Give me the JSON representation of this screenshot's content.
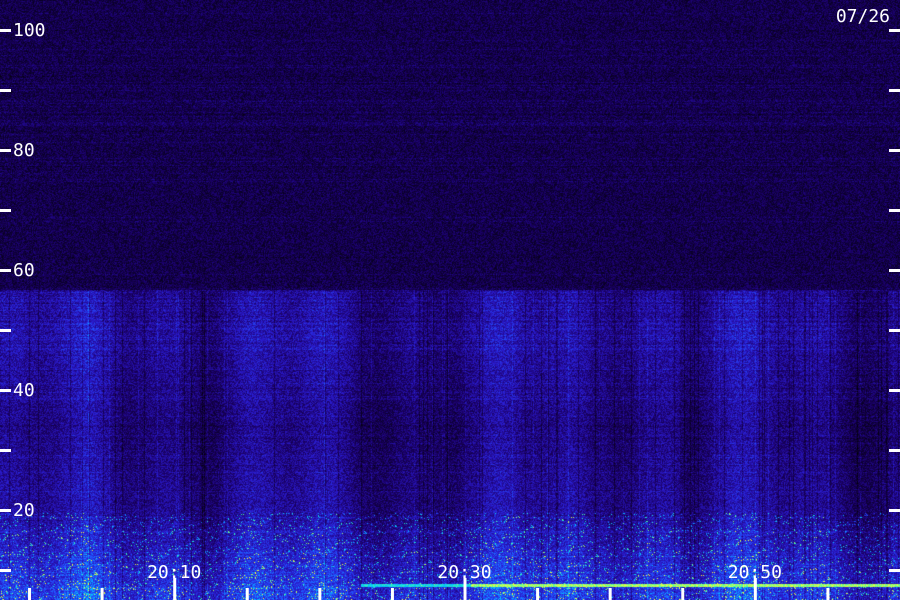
{
  "chart_data": {
    "type": "heatmap",
    "date_label": "07/26",
    "y_ticks": [
      {
        "value": 100,
        "label": "100"
      },
      {
        "value": 90,
        "label": ""
      },
      {
        "value": 80,
        "label": "80"
      },
      {
        "value": 70,
        "label": ""
      },
      {
        "value": 60,
        "label": "60"
      },
      {
        "value": 50,
        "label": ""
      },
      {
        "value": 40,
        "label": "40"
      },
      {
        "value": 30,
        "label": ""
      },
      {
        "value": 20,
        "label": "20"
      },
      {
        "value": 10,
        "label": ""
      }
    ],
    "ylim": [
      0,
      100
    ],
    "x_major_ticks": [
      {
        "value": "20:10",
        "label": "20:10"
      },
      {
        "value": "20:30",
        "label": "20:30"
      },
      {
        "value": "20:50",
        "label": "20:50"
      }
    ],
    "x_minor_ticks": [
      "20:00",
      "20:05",
      "20:15",
      "20:20",
      "20:25",
      "20:35",
      "20:40",
      "20:45",
      "20:55"
    ],
    "xlim": [
      "19:58",
      "21:00"
    ],
    "grid": false,
    "colormap": [
      "#000000",
      "#1a0066",
      "#2a1acc",
      "#2255ff",
      "#00c8ff",
      "#44ffaa",
      "#ffff33"
    ]
  }
}
